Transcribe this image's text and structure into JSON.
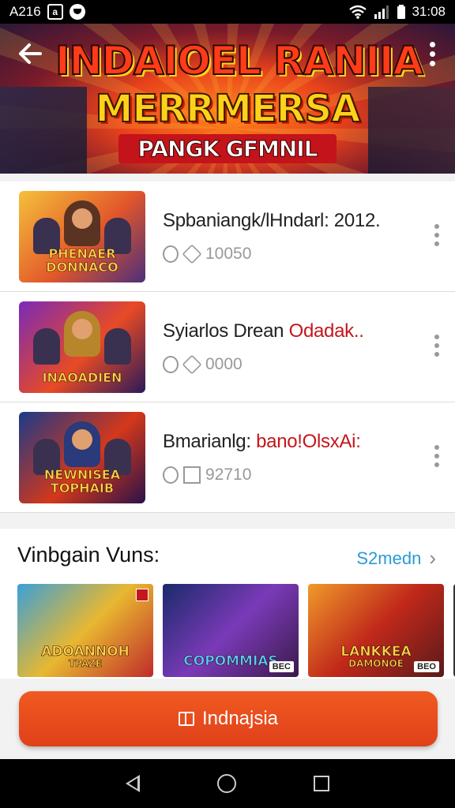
{
  "status_bar": {
    "left_text": "A216",
    "time": "31:08"
  },
  "header": {
    "title_line1": "INDAIOEL RANIIA",
    "title_line2": "MERRMERSA",
    "title_line3": "PANGK GFMNIL"
  },
  "list": [
    {
      "title": "Spbaniangk/lHndarl: 2012.",
      "title_highlight": "",
      "stat": "10050",
      "thumb_text": "PHENAER DONNACO",
      "colors": [
        "#f5c13a",
        "#e2562a",
        "#4b2f7a"
      ]
    },
    {
      "title": "Syiarlos Drean ",
      "title_highlight": "Odadak..",
      "stat": "0000",
      "thumb_text": "INAOADIEN",
      "colors": [
        "#7a2ab8",
        "#e84a24",
        "#2a1a5a"
      ]
    },
    {
      "title": "Bmarianlg: ",
      "title_highlight": "bano!OlsxAi:",
      "stat": "92710",
      "thumb_text": "NEWNISEA TOPHAIB",
      "colors": [
        "#1a3a8a",
        "#d4381a",
        "#2a124a"
      ]
    }
  ],
  "section": {
    "title": "Vinbgain Vuns:",
    "link": "S2medn",
    "cards": [
      {
        "text": "ADOANNOH",
        "sub": "TPAZE",
        "tag": "",
        "colors": [
          "#3aa0d8",
          "#e8b830",
          "#c02a2a"
        ]
      },
      {
        "text": "COPOMMIAS",
        "sub": "",
        "tag": "BEC",
        "colors": [
          "#1a2a6a",
          "#7a3ab8",
          "#3a1a4a"
        ]
      },
      {
        "text": "LANKKEA",
        "sub": "DAMONOE",
        "tag": "BEO",
        "colors": [
          "#f09a2a",
          "#c0281a",
          "#5a1a1a"
        ]
      }
    ]
  },
  "cta": {
    "label": "Indnajsia"
  }
}
